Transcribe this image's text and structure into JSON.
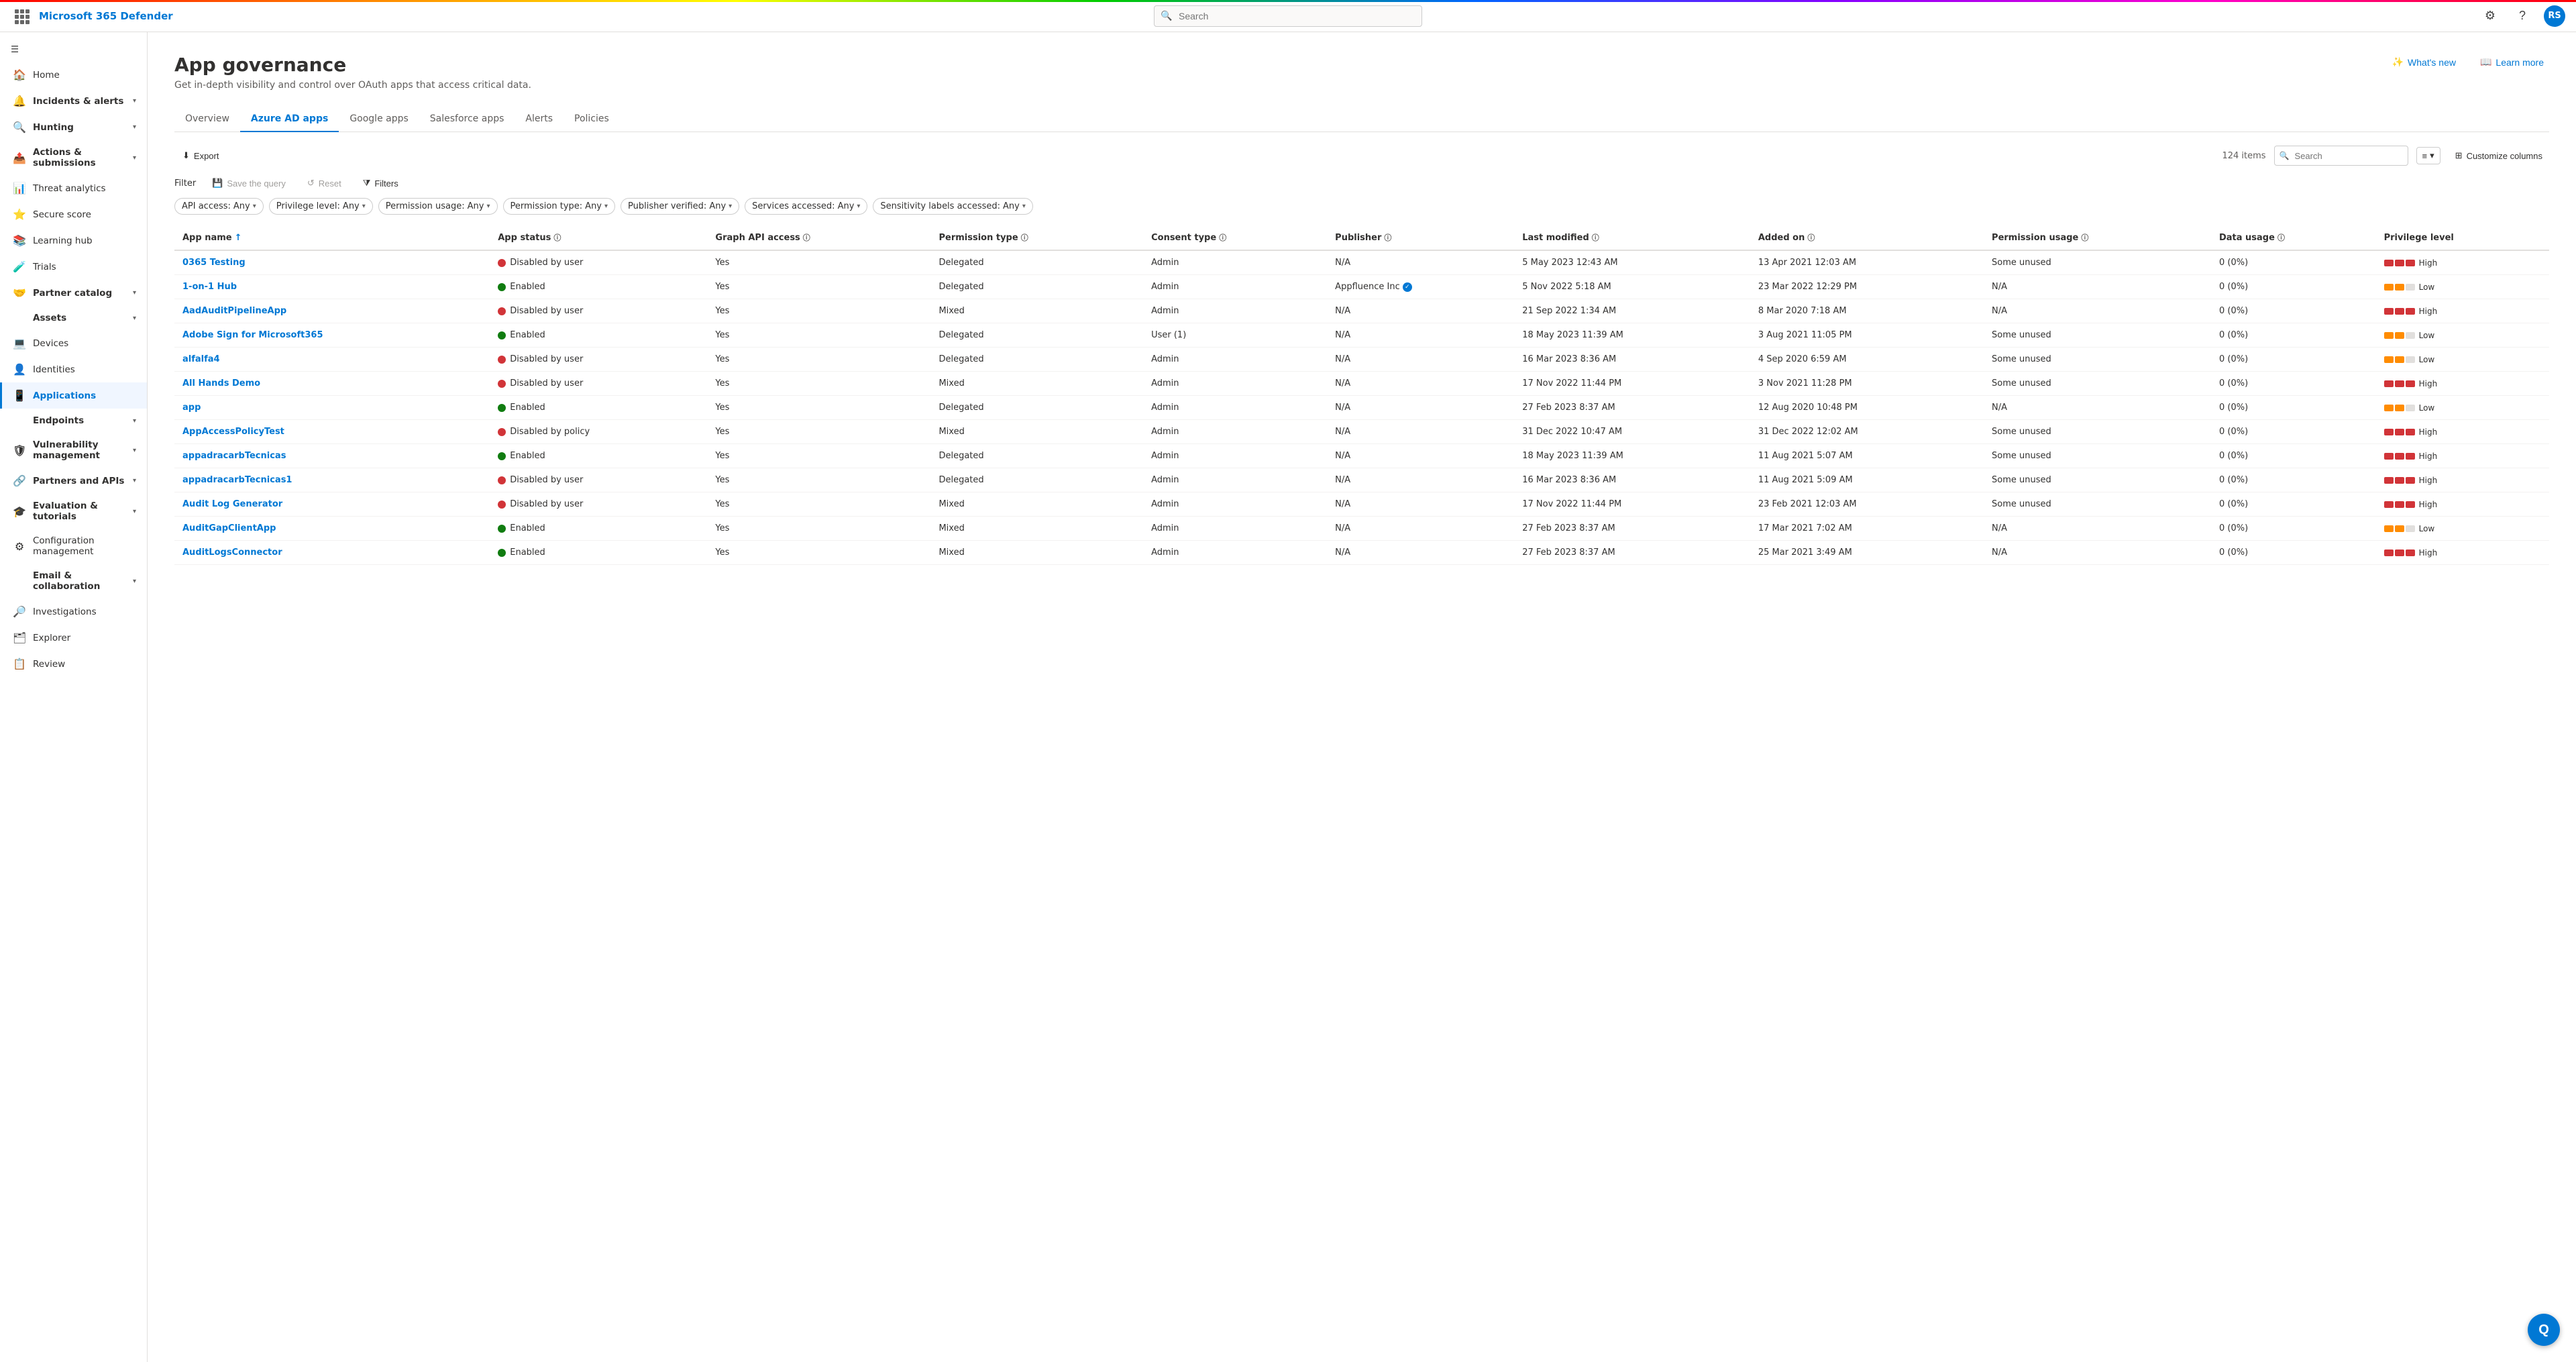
{
  "app": {
    "title": "Microsoft 365 Defender"
  },
  "topbar": {
    "search_placeholder": "Search",
    "avatar_initials": "RS"
  },
  "sidebar": {
    "collapse_label": "Collapse",
    "items": [
      {
        "id": "home",
        "label": "Home",
        "icon": "🏠",
        "expandable": false
      },
      {
        "id": "incidents",
        "label": "Incidents & alerts",
        "icon": "🔔",
        "expandable": true
      },
      {
        "id": "hunting",
        "label": "Hunting",
        "icon": "🔍",
        "expandable": true
      },
      {
        "id": "actions",
        "label": "Actions & submissions",
        "icon": "📤",
        "expandable": true
      },
      {
        "id": "threat",
        "label": "Threat analytics",
        "icon": "📊",
        "expandable": false
      },
      {
        "id": "secure",
        "label": "Secure score",
        "icon": "⭐",
        "expandable": false
      },
      {
        "id": "learning",
        "label": "Learning hub",
        "icon": "📚",
        "expandable": false
      },
      {
        "id": "trials",
        "label": "Trials",
        "icon": "🧪",
        "expandable": false
      },
      {
        "id": "partner",
        "label": "Partner catalog",
        "icon": "🤝",
        "expandable": true
      },
      {
        "id": "assets-header",
        "label": "Assets",
        "icon": "",
        "section": true,
        "expandable": true
      },
      {
        "id": "devices",
        "label": "Devices",
        "icon": "💻",
        "expandable": false
      },
      {
        "id": "identities",
        "label": "Identities",
        "icon": "👤",
        "expandable": false
      },
      {
        "id": "applications",
        "label": "Applications",
        "icon": "📱",
        "expandable": false,
        "active": true
      },
      {
        "id": "endpoints-header",
        "label": "Endpoints",
        "icon": "",
        "section": true,
        "expandable": true
      },
      {
        "id": "vulnerability",
        "label": "Vulnerability management",
        "icon": "🛡",
        "expandable": true
      },
      {
        "id": "partners-apis",
        "label": "Partners and APIs",
        "icon": "🔗",
        "expandable": true
      },
      {
        "id": "evaluation",
        "label": "Evaluation & tutorials",
        "icon": "🎓",
        "expandable": true
      },
      {
        "id": "config",
        "label": "Configuration management",
        "icon": "⚙",
        "expandable": false
      },
      {
        "id": "email-header",
        "label": "Email & collaboration",
        "icon": "",
        "section": true,
        "expandable": true
      },
      {
        "id": "investigations",
        "label": "Investigations",
        "icon": "🔎",
        "expandable": false
      },
      {
        "id": "explorer",
        "label": "Explorer",
        "icon": "🗂",
        "expandable": false
      },
      {
        "id": "review",
        "label": "Review",
        "icon": "📋",
        "expandable": false
      }
    ]
  },
  "page": {
    "title": "App governance",
    "subtitle": "Get in-depth visibility and control over OAuth apps that access critical data.",
    "whats_new_label": "What's new",
    "learn_more_label": "Learn more"
  },
  "tabs": [
    {
      "id": "overview",
      "label": "Overview"
    },
    {
      "id": "azure-ad",
      "label": "Azure AD apps",
      "active": true
    },
    {
      "id": "google",
      "label": "Google apps"
    },
    {
      "id": "salesforce",
      "label": "Salesforce apps"
    },
    {
      "id": "alerts",
      "label": "Alerts"
    },
    {
      "id": "policies",
      "label": "Policies"
    }
  ],
  "toolbar": {
    "export_label": "Export",
    "filter_label": "Filter",
    "save_query_label": "Save the query",
    "reset_label": "Reset",
    "filters_label": "Filters",
    "items_count": "124 items",
    "search_placeholder": "Search",
    "customize_columns_label": "Customize columns"
  },
  "filters": [
    {
      "id": "api-access",
      "label": "API access:",
      "value": "Any"
    },
    {
      "id": "privilege-level",
      "label": "Privilege level:",
      "value": "Any"
    },
    {
      "id": "permission-usage",
      "label": "Permission usage:",
      "value": "Any"
    },
    {
      "id": "permission-type",
      "label": "Permission type:",
      "value": "Any"
    },
    {
      "id": "publisher-verified",
      "label": "Publisher verified:",
      "value": "Any"
    },
    {
      "id": "services-accessed",
      "label": "Services accessed:",
      "value": "Any"
    },
    {
      "id": "sensitivity-labels",
      "label": "Sensitivity labels accessed:",
      "value": "Any"
    }
  ],
  "table": {
    "columns": [
      {
        "id": "app-name",
        "label": "App name",
        "sortable": true,
        "sort_asc": true
      },
      {
        "id": "app-status",
        "label": "App status",
        "info": true
      },
      {
        "id": "graph-api",
        "label": "Graph API access",
        "info": true
      },
      {
        "id": "permission-type",
        "label": "Permission type",
        "info": true
      },
      {
        "id": "consent-type",
        "label": "Consent type",
        "info": true
      },
      {
        "id": "publisher",
        "label": "Publisher",
        "info": true
      },
      {
        "id": "last-modified",
        "label": "Last modified",
        "info": true
      },
      {
        "id": "added-on",
        "label": "Added on",
        "info": true
      },
      {
        "id": "permission-usage",
        "label": "Permission usage",
        "info": true
      },
      {
        "id": "data-usage",
        "label": "Data usage",
        "info": true
      },
      {
        "id": "privilege-level",
        "label": "Privilege level"
      }
    ],
    "rows": [
      {
        "app_name": "0365 Testing",
        "app_status": "Disabled by user",
        "app_status_type": "disabled",
        "graph_api": "Yes",
        "permission_type": "Delegated",
        "consent_type": "Admin",
        "publisher": "N/A",
        "publisher_verified": false,
        "last_modified": "5 May 2023 12:43 AM",
        "added_on": "13 Apr 2021 12:03 AM",
        "permission_usage": "Some unused",
        "data_usage": "0 (0%)",
        "privilege_level": "High",
        "privilege_type": "high"
      },
      {
        "app_name": "1-on-1 Hub",
        "app_status": "Enabled",
        "app_status_type": "enabled",
        "graph_api": "Yes",
        "permission_type": "Delegated",
        "consent_type": "Admin",
        "publisher": "Appfluence Inc",
        "publisher_verified": true,
        "last_modified": "5 Nov 2022 5:18 AM",
        "added_on": "23 Mar 2022 12:29 PM",
        "permission_usage": "N/A",
        "data_usage": "0 (0%)",
        "privilege_level": "Low",
        "privilege_type": "low"
      },
      {
        "app_name": "AadAuditPipelineApp",
        "app_status": "Disabled by user",
        "app_status_type": "disabled",
        "graph_api": "Yes",
        "permission_type": "Mixed",
        "consent_type": "Admin",
        "publisher": "N/A",
        "publisher_verified": false,
        "last_modified": "21 Sep 2022 1:34 AM",
        "added_on": "8 Mar 2020 7:18 AM",
        "permission_usage": "N/A",
        "data_usage": "0 (0%)",
        "privilege_level": "High",
        "privilege_type": "high"
      },
      {
        "app_name": "Adobe Sign for Microsoft365",
        "app_status": "Enabled",
        "app_status_type": "enabled",
        "graph_api": "Yes",
        "permission_type": "Delegated",
        "consent_type": "User (1)",
        "publisher": "N/A",
        "publisher_verified": false,
        "last_modified": "18 May 2023 11:39 AM",
        "added_on": "3 Aug 2021 11:05 PM",
        "permission_usage": "Some unused",
        "data_usage": "0 (0%)",
        "privilege_level": "Low",
        "privilege_type": "low"
      },
      {
        "app_name": "alfalfa4",
        "app_status": "Disabled by user",
        "app_status_type": "disabled",
        "graph_api": "Yes",
        "permission_type": "Delegated",
        "consent_type": "Admin",
        "publisher": "N/A",
        "publisher_verified": false,
        "last_modified": "16 Mar 2023 8:36 AM",
        "added_on": "4 Sep 2020 6:59 AM",
        "permission_usage": "Some unused",
        "data_usage": "0 (0%)",
        "privilege_level": "Low",
        "privilege_type": "low"
      },
      {
        "app_name": "All Hands Demo",
        "app_status": "Disabled by user",
        "app_status_type": "disabled",
        "graph_api": "Yes",
        "permission_type": "Mixed",
        "consent_type": "Admin",
        "publisher": "N/A",
        "publisher_verified": false,
        "last_modified": "17 Nov 2022 11:44 PM",
        "added_on": "3 Nov 2021 11:28 PM",
        "permission_usage": "Some unused",
        "data_usage": "0 (0%)",
        "privilege_level": "High",
        "privilege_type": "high"
      },
      {
        "app_name": "app",
        "app_status": "Enabled",
        "app_status_type": "enabled",
        "graph_api": "Yes",
        "permission_type": "Delegated",
        "consent_type": "Admin",
        "publisher": "N/A",
        "publisher_verified": false,
        "last_modified": "27 Feb 2023 8:37 AM",
        "added_on": "12 Aug 2020 10:48 PM",
        "permission_usage": "N/A",
        "data_usage": "0 (0%)",
        "privilege_level": "Low",
        "privilege_type": "low"
      },
      {
        "app_name": "AppAccessPolicyTest",
        "app_status": "Disabled by policy",
        "app_status_type": "disabled",
        "graph_api": "Yes",
        "permission_type": "Mixed",
        "consent_type": "Admin",
        "publisher": "N/A",
        "publisher_verified": false,
        "last_modified": "31 Dec 2022 10:47 AM",
        "added_on": "31 Dec 2022 12:02 AM",
        "permission_usage": "Some unused",
        "data_usage": "0 (0%)",
        "privilege_level": "High",
        "privilege_type": "high"
      },
      {
        "app_name": "appadracarbTecnicas",
        "app_status": "Enabled",
        "app_status_type": "enabled",
        "graph_api": "Yes",
        "permission_type": "Delegated",
        "consent_type": "Admin",
        "publisher": "N/A",
        "publisher_verified": false,
        "last_modified": "18 May 2023 11:39 AM",
        "added_on": "11 Aug 2021 5:07 AM",
        "permission_usage": "Some unused",
        "data_usage": "0 (0%)",
        "privilege_level": "High",
        "privilege_type": "high"
      },
      {
        "app_name": "appadracarbTecnicas1",
        "app_status": "Disabled by user",
        "app_status_type": "disabled",
        "graph_api": "Yes",
        "permission_type": "Delegated",
        "consent_type": "Admin",
        "publisher": "N/A",
        "publisher_verified": false,
        "last_modified": "16 Mar 2023 8:36 AM",
        "added_on": "11 Aug 2021 5:09 AM",
        "permission_usage": "Some unused",
        "data_usage": "0 (0%)",
        "privilege_level": "High",
        "privilege_type": "high"
      },
      {
        "app_name": "Audit Log Generator",
        "app_status": "Disabled by user",
        "app_status_type": "disabled",
        "graph_api": "Yes",
        "permission_type": "Mixed",
        "consent_type": "Admin",
        "publisher": "N/A",
        "publisher_verified": false,
        "last_modified": "17 Nov 2022 11:44 PM",
        "added_on": "23 Feb 2021 12:03 AM",
        "permission_usage": "Some unused",
        "data_usage": "0 (0%)",
        "privilege_level": "High",
        "privilege_type": "high"
      },
      {
        "app_name": "AuditGapClientApp",
        "app_status": "Enabled",
        "app_status_type": "enabled",
        "graph_api": "Yes",
        "permission_type": "Mixed",
        "consent_type": "Admin",
        "publisher": "N/A",
        "publisher_verified": false,
        "last_modified": "27 Feb 2023 8:37 AM",
        "added_on": "17 Mar 2021 7:02 AM",
        "permission_usage": "N/A",
        "data_usage": "0 (0%)",
        "privilege_level": "Low",
        "privilege_type": "low"
      },
      {
        "app_name": "AuditLogsConnector",
        "app_status": "Enabled",
        "app_status_type": "enabled",
        "graph_api": "Yes",
        "permission_type": "Mixed",
        "consent_type": "Admin",
        "publisher": "N/A",
        "publisher_verified": false,
        "last_modified": "27 Feb 2023 8:37 AM",
        "added_on": "25 Mar 2021 3:49 AM",
        "permission_usage": "N/A",
        "data_usage": "0 (0%)",
        "privilege_level": "High",
        "privilege_type": "high"
      }
    ]
  },
  "floating_btn": {
    "label": "Q"
  }
}
